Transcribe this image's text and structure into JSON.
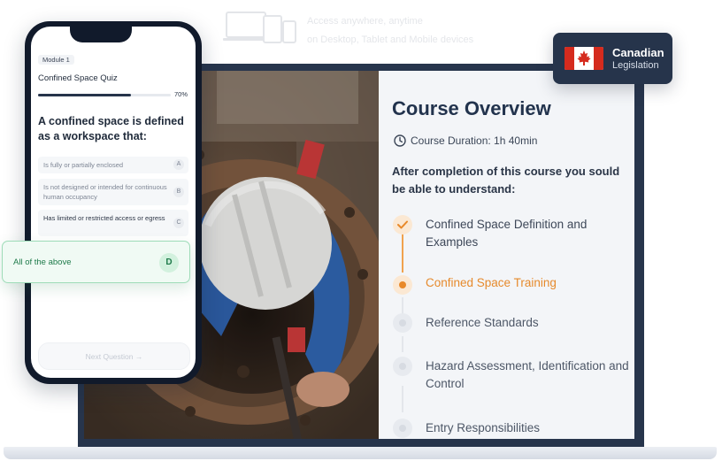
{
  "top_caption": {
    "line1": "Access anywhere, anytime",
    "line2": "on Desktop, Tablet and Mobile devices"
  },
  "badge": {
    "country_label": "Canadian",
    "legislation_label": "Legislation",
    "flag": "canada-flag"
  },
  "course": {
    "title": "Course Overview",
    "duration": "Course Duration: 1h 40min",
    "subtitle": "After completion of this course you sould be able to understand:",
    "topics": [
      {
        "label": "Confined Space Definition and Examples",
        "status": "completed"
      },
      {
        "label": "Confined Space Training",
        "status": "current"
      },
      {
        "label": "Reference Standards",
        "status": "upcoming"
      },
      {
        "label": "Hazard Assessment, Identification and Control",
        "status": "upcoming"
      },
      {
        "label": "Entry Responsibilities",
        "status": "upcoming"
      }
    ],
    "accent_color": "#e8892a"
  },
  "phone": {
    "module": "Module 1",
    "quiz_title": "Confined Space Quiz",
    "progress_label": "70%",
    "progress": 0.7,
    "question": "A confined space is defined as a workspace that:",
    "options": [
      {
        "text": "Is fully or partially enclosed",
        "letter": "A"
      },
      {
        "text": "Is not designed or intended for continuous human occupancy",
        "letter": "B"
      },
      {
        "text": "Has limited or restricted access or egress",
        "letter": "C"
      }
    ],
    "selected": {
      "text": "All of the above",
      "letter": "D"
    },
    "next_button": "Next Question →"
  }
}
